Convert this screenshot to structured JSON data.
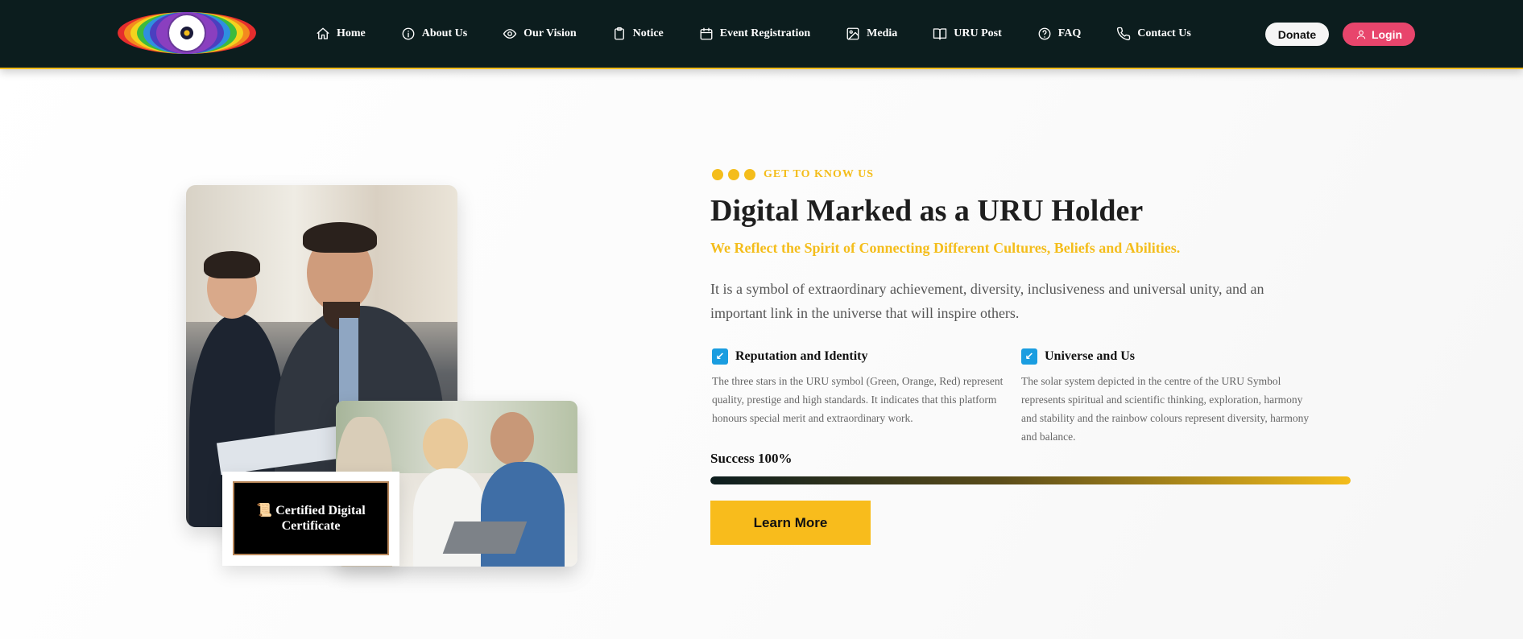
{
  "header": {
    "logo_icon": "uru-rainbow-logo",
    "nav": [
      {
        "label": "Home",
        "icon": "home-icon"
      },
      {
        "label": "About Us",
        "icon": "info-icon"
      },
      {
        "label": "Our Vision",
        "icon": "eye-icon"
      },
      {
        "label": "Notice",
        "icon": "clipboard-icon"
      },
      {
        "label": "Event Registration",
        "icon": "calendar-icon"
      },
      {
        "label": "Media",
        "icon": "image-icon"
      },
      {
        "label": "URU Post",
        "icon": "book-icon"
      },
      {
        "label": "FAQ",
        "icon": "help-circle-icon"
      },
      {
        "label": "Contact Us",
        "icon": "phone-icon"
      }
    ],
    "donate_label": "Donate",
    "login_label": "Login"
  },
  "media": {
    "certificate_label": "📜 Certified Digital Certificate"
  },
  "about": {
    "eyebrow": "GET TO KNOW US",
    "title": "Digital Marked as a URU Holder",
    "subtitle": "We Reflect the Spirit of Connecting Different Cultures, Beliefs and Abilities.",
    "lead": "It is a symbol of extraordinary achievement, diversity, inclusiveness and universal unity, and an important link in the universe that will inspire others.",
    "features": [
      {
        "title": "Reputation and Identity",
        "text": "The three stars in the URU symbol (Green, Orange, Red) represent quality, prestige and high standards. It indicates that this platform honours special merit and extraordinary work."
      },
      {
        "title": "Universe and Us",
        "text": "The solar system depicted in the centre of the URU Symbol represents spiritual and scientific thinking, exploration, harmony and stability and the rainbow colours represent diversity, harmony and balance."
      }
    ],
    "success_label": "Success 100%",
    "success_value": 100,
    "cta_label": "Learn More"
  },
  "colors": {
    "nav_bg": "#0c1d1e",
    "accent_gold": "#f4bd1b",
    "login_pink": "#e8456c",
    "check_blue": "#1a9de0"
  }
}
